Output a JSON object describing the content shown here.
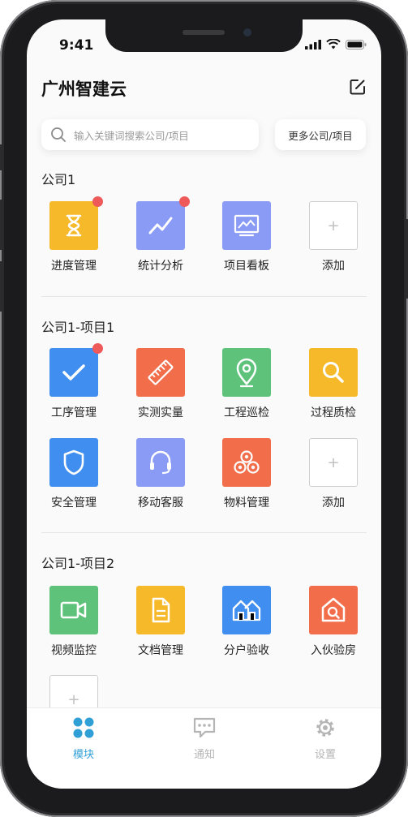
{
  "status": {
    "time": "9:41"
  },
  "app_title": "广州智建云",
  "search": {
    "placeholder": "输入关键词搜索公司/项目"
  },
  "more_button": "更多公司/项目",
  "sections": [
    {
      "title": "公司1",
      "tiles": [
        {
          "label": "进度管理",
          "color": "#f5b92a",
          "icon": "hourglass-icon",
          "badge": true
        },
        {
          "label": "统计分析",
          "color": "#8a9bf5",
          "icon": "trend-chart-icon",
          "badge": true
        },
        {
          "label": "项目看板",
          "color": "#8a9bf5",
          "icon": "dashboard-icon",
          "badge": false
        },
        {
          "label": "添加",
          "icon": "plus-icon",
          "add": true
        }
      ]
    },
    {
      "title": "公司1-项目1",
      "tiles": [
        {
          "label": "工序管理",
          "color": "#3f8ef0",
          "icon": "checkmark-icon",
          "badge": true
        },
        {
          "label": "实测实量",
          "color": "#f26e4b",
          "icon": "ruler-icon",
          "badge": false
        },
        {
          "label": "工程巡检",
          "color": "#5ec27b",
          "icon": "location-pin-icon",
          "badge": false
        },
        {
          "label": "过程质检",
          "color": "#f5b92a",
          "icon": "magnifier-icon",
          "badge": false
        },
        {
          "label": "安全管理",
          "color": "#3f8ef0",
          "icon": "shield-icon",
          "badge": false
        },
        {
          "label": "移动客服",
          "color": "#8a9bf5",
          "icon": "headset-icon",
          "badge": false
        },
        {
          "label": "物料管理",
          "color": "#f26e4b",
          "icon": "material-rolls-icon",
          "badge": false
        },
        {
          "label": "添加",
          "icon": "plus-icon",
          "add": true
        }
      ]
    },
    {
      "title": "公司1-项目2",
      "tiles": [
        {
          "label": "视频监控",
          "color": "#5ec27b",
          "icon": "video-camera-icon",
          "badge": false
        },
        {
          "label": "文档管理",
          "color": "#f5b92a",
          "icon": "document-icon",
          "badge": false
        },
        {
          "label": "分户验收",
          "color": "#3f8ef0",
          "icon": "houses-icon",
          "badge": false
        },
        {
          "label": "入伙验房",
          "color": "#f26e4b",
          "icon": "house-search-icon",
          "badge": false
        },
        {
          "label": "",
          "icon": "plus-icon",
          "add": true
        }
      ]
    }
  ],
  "tabbar": [
    {
      "label": "模块",
      "icon": "grid-dots-icon",
      "active": true
    },
    {
      "label": "通知",
      "icon": "chat-bubble-icon",
      "active": false
    },
    {
      "label": "设置",
      "icon": "gear-icon",
      "active": false
    }
  ],
  "colors": {
    "tab_active": "#2f9fd6",
    "tab_inactive": "#b5b5b5"
  }
}
